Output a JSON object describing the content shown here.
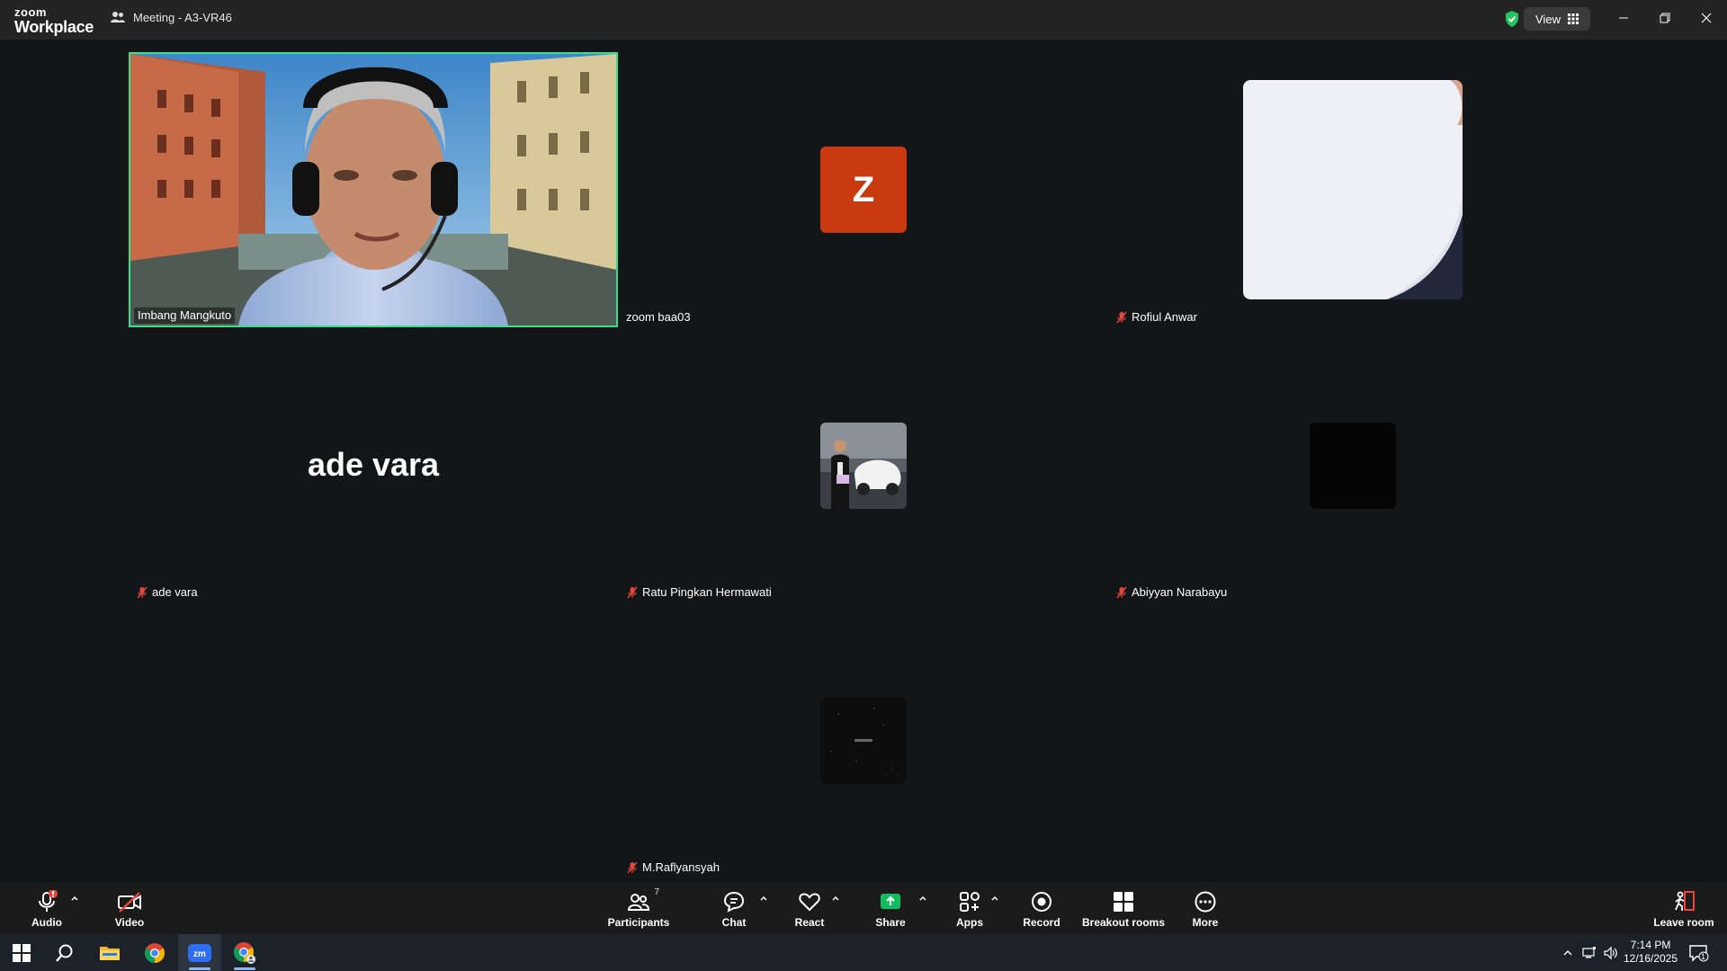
{
  "app": {
    "brand_top": "zoom",
    "brand_bottom": "Workplace",
    "meeting_title": "Meeting - A3-VR46",
    "view_label": "View"
  },
  "participants": [
    {
      "name": "Imbang Mangkuto",
      "muted": false,
      "kind": "video"
    },
    {
      "name": "zoom baa03",
      "muted": false,
      "kind": "avatar-letter",
      "letter": "Z",
      "color": "#c8390f"
    },
    {
      "name": "Rofiul Anwar",
      "muted": true,
      "kind": "video-white"
    },
    {
      "name": "ade vara",
      "muted": true,
      "kind": "name-only"
    },
    {
      "name": "Ratu Pingkan Hermawati",
      "muted": true,
      "kind": "avatar-photo"
    },
    {
      "name": "Abiyyan Narabayu",
      "muted": true,
      "kind": "avatar-black"
    },
    {
      "name": "M.Raflyansyah",
      "muted": true,
      "kind": "avatar-dark"
    }
  ],
  "toolbar": {
    "audio": "Audio",
    "video": "Video",
    "participants": "Participants",
    "participants_count": "7",
    "chat": "Chat",
    "react": "React",
    "share": "Share",
    "apps": "Apps",
    "record": "Record",
    "breakout": "Breakout rooms",
    "more": "More",
    "leave": "Leave room"
  },
  "taskbar": {
    "time": "7:14 PM",
    "date": "12/16/2025",
    "notifications": "1"
  },
  "colors": {
    "active_speaker": "#35e08a",
    "share_green": "#0fbf5f",
    "muted_red": "#e5453b"
  }
}
